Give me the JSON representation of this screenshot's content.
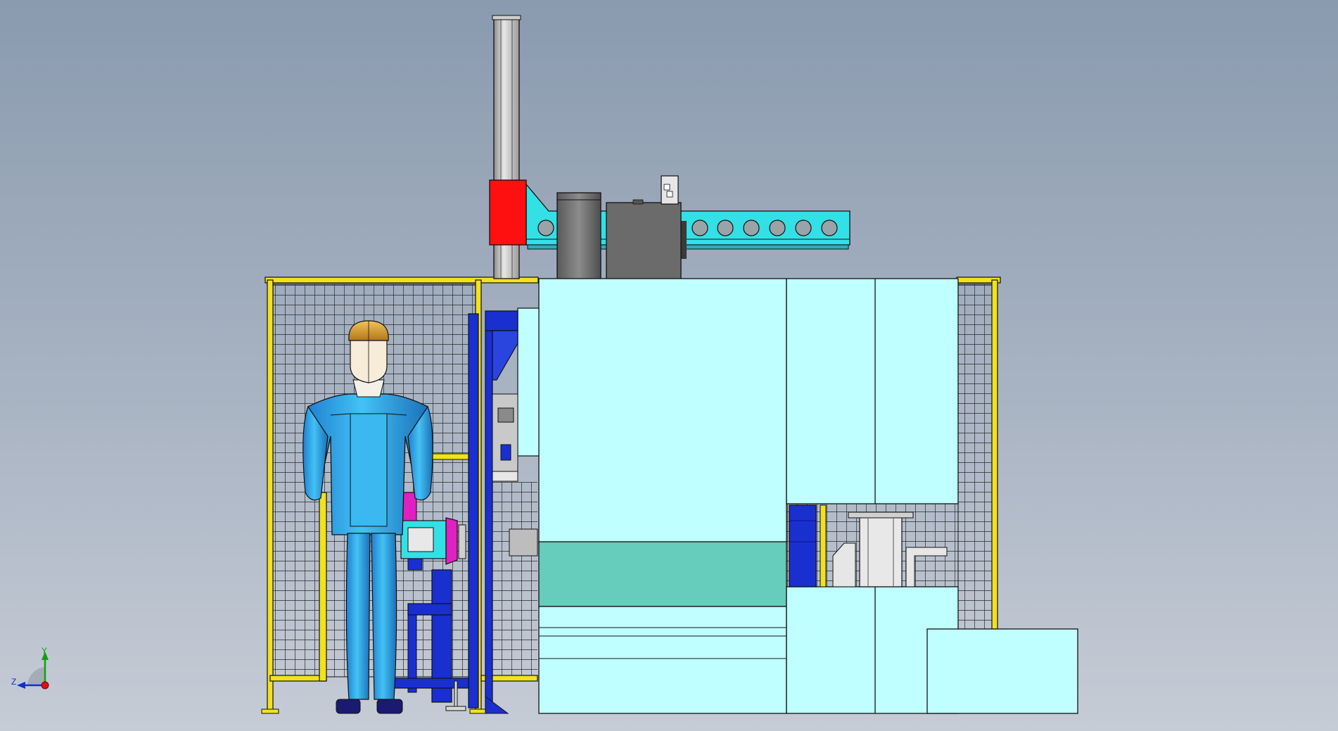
{
  "viewport": {
    "background_top": "#8a9aaf",
    "background_bottom": "#c6ccd6"
  },
  "colors": {
    "guard_frame": "#f2e21e",
    "guard_mesh": "#2a2a2a",
    "machine_body": "#c0ffff",
    "machine_band": "#66ccbb",
    "outline": "#111111",
    "fixture_blue": "#1a2fd0",
    "gantry_cyan": "#33e0e6",
    "gantry_red": "#ff1010",
    "column_grey": "#bdbdbd",
    "motor_grey": "#707070",
    "operator_suit": "#2aa7e8",
    "operator_helmet": "#e0a030",
    "operator_boots": "#1a1a70",
    "workpiece_magenta": "#e020c0"
  },
  "triad": {
    "y_label": "Y",
    "z_label": "Z",
    "x_color": "#e01010",
    "y_color": "#10a010",
    "z_color": "#1030d0"
  }
}
